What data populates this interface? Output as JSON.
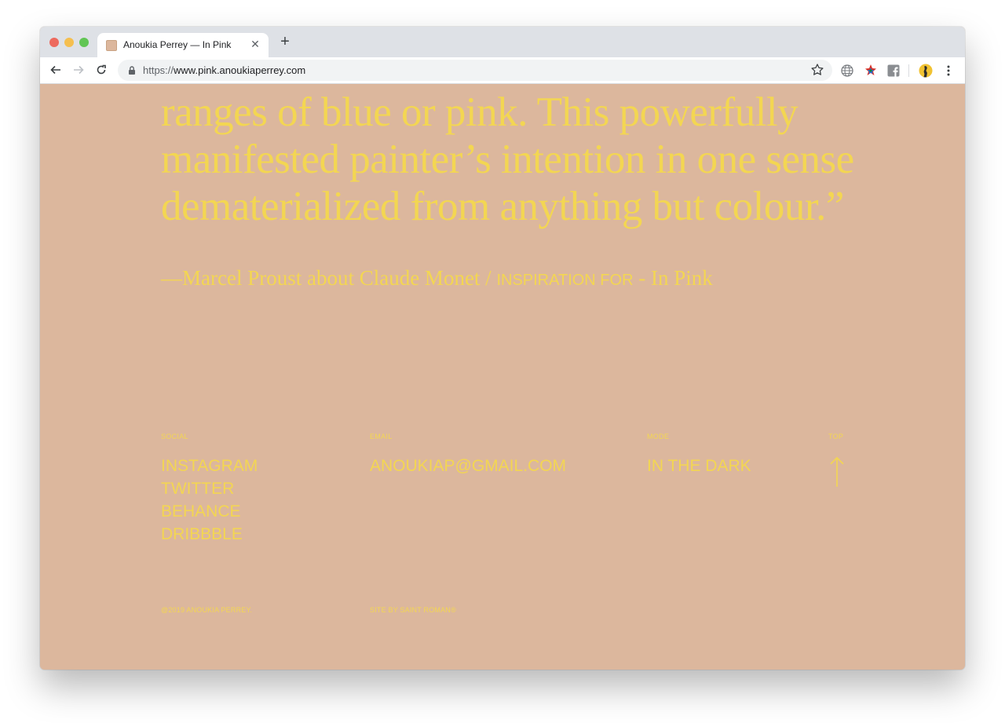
{
  "browser": {
    "tab_title": "Anoukia Perrey — In Pink",
    "url_scheme": "https://",
    "url_host": "www.pink.anoukiaperrey.com"
  },
  "quote": {
    "lines": [
      "ranges of blue or pink. This powerfully",
      "manifested painter’s intention in one sense",
      "dematerialized from anything but colour.”"
    ],
    "attribution_serif": "—Marcel Proust about Claude Monet /",
    "attribution_sans": "INSPIRATION FOR",
    "attribution_tail": "- In Pink"
  },
  "footer": {
    "social_label": "SOCIAL",
    "social_links": [
      "INSTAGRAM",
      "TWITTER",
      "BEHANCE",
      "DRIBBBLE"
    ],
    "email_label": "EMAIL",
    "email": "ANOUKIAP@GMAIL.COM",
    "mode_label": "MODE",
    "mode_link": "IN THE DARK",
    "top_label": "TOP",
    "copyright": "@2019 ANOUKIA PERREY.",
    "credit": "SITE BY SAINT ROMAN®"
  },
  "colors": {
    "background": "#dcb79d",
    "accent": "#f3d652"
  },
  "icons": [
    "back-arrow-icon",
    "forward-arrow-icon",
    "reload-icon",
    "lock-icon",
    "star-icon",
    "globe-icon",
    "extension-icon",
    "facebook-icon",
    "profile-avatar-icon",
    "menu-kebab-icon",
    "arrow-up-icon"
  ]
}
